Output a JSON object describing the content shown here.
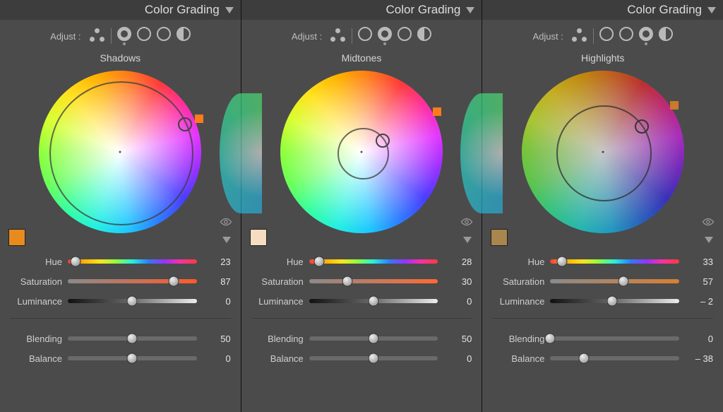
{
  "panels": [
    {
      "header": "Color Grading",
      "adjust_label": "Adjust :",
      "selected_mode": 0,
      "section": "Shadows",
      "swatch": "#e88b1f",
      "hue_marker": "#ff7a1a",
      "sat_track_to": "#ff5a2a",
      "ring_pct": 87,
      "knob_angle": 23,
      "sliders": {
        "hue": {
          "label": "Hue",
          "value": 23,
          "pos": 6
        },
        "saturation": {
          "label": "Saturation",
          "value": 87,
          "pos": 82
        },
        "luminance": {
          "label": "Luminance",
          "value": 0,
          "pos": 50
        }
      },
      "bottom": {
        "blending": {
          "label": "Blending",
          "value": 50,
          "pos": 50
        },
        "balance": {
          "label": "Balance",
          "value": 0,
          "pos": 50
        }
      }
    },
    {
      "header": "Color Grading",
      "adjust_label": "Adjust :",
      "selected_mode": 1,
      "section": "Midtones",
      "swatch": "#f6dcc0",
      "hue_marker": "#ff7a1a",
      "sat_track_to": "#ff6a33",
      "ring_pct": 30,
      "knob_angle": 28,
      "sliders": {
        "hue": {
          "label": "Hue",
          "value": 28,
          "pos": 8
        },
        "saturation": {
          "label": "Saturation",
          "value": 30,
          "pos": 30
        },
        "luminance": {
          "label": "Luminance",
          "value": 0,
          "pos": 50
        }
      },
      "bottom": {
        "blending": {
          "label": "Blending",
          "value": 50,
          "pos": 50
        },
        "balance": {
          "label": "Balance",
          "value": 0,
          "pos": 50
        }
      }
    },
    {
      "header": "Color Grading",
      "adjust_label": "Adjust :",
      "selected_mode": 2,
      "section": "Highlights",
      "swatch": "#a9864e",
      "hue_marker": "#c97a2a",
      "sat_track_to": "#d97f33",
      "ring_pct": 57,
      "knob_angle": 33,
      "dim": true,
      "sliders": {
        "hue": {
          "label": "Hue",
          "value": 33,
          "pos": 9
        },
        "saturation": {
          "label": "Saturation",
          "value": 57,
          "pos": 57
        },
        "luminance": {
          "label": "Luminance",
          "value": "– 2",
          "pos": 48
        }
      },
      "bottom": {
        "blending": {
          "label": "Blending",
          "value": 0,
          "pos": 0
        },
        "balance": {
          "label": "Balance",
          "value": "– 38",
          "pos": 26
        }
      }
    }
  ]
}
